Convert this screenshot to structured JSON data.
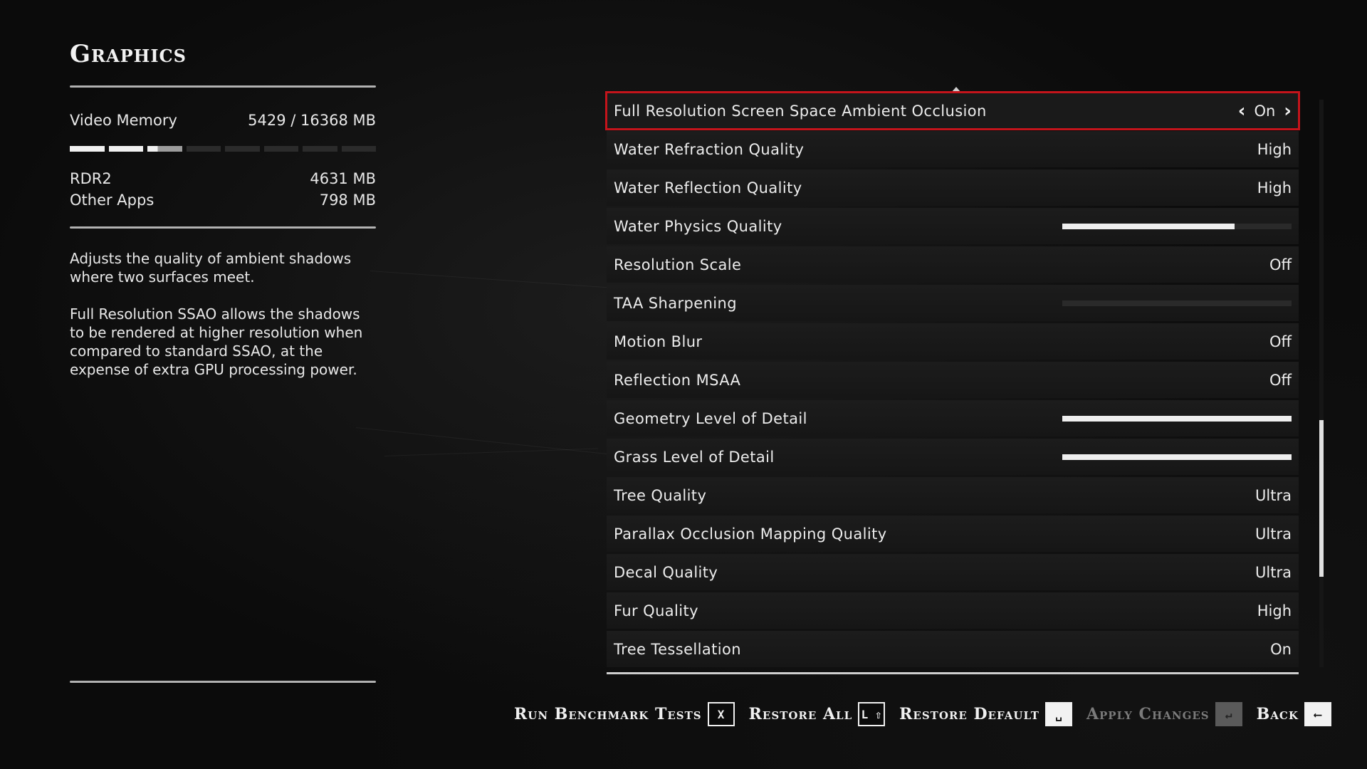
{
  "panel": {
    "title": "Graphics",
    "video_memory_label": "Video Memory",
    "video_memory_value": "5429  / 16368  MB",
    "memory_usage_fraction": 0.332,
    "rdr2_label": "RDR2",
    "rdr2_value": "4631  MB",
    "other_apps_label": "Other Apps",
    "other_apps_value": "798  MB",
    "description_1": "Adjusts the quality of ambient shadows where two surfaces meet.",
    "description_2": "Full Resolution SSAO allows the shadows to be rendered at higher resolution when compared to standard SSAO, at the expense of extra GPU processing power."
  },
  "settings": [
    {
      "label": "Full Resolution Screen Space Ambient Occlusion",
      "value": "On",
      "selected": true,
      "type": "option"
    },
    {
      "label": "Water Refraction Quality",
      "value": "High",
      "type": "option"
    },
    {
      "label": "Water Reflection Quality",
      "value": "High",
      "type": "option"
    },
    {
      "label": "Water Physics Quality",
      "type": "slider",
      "fill": 0.75
    },
    {
      "label": "Resolution Scale",
      "value": "Off",
      "type": "option"
    },
    {
      "label": "TAA Sharpening",
      "type": "slider",
      "fill": 0.0
    },
    {
      "label": "Motion Blur",
      "value": "Off",
      "type": "option"
    },
    {
      "label": "Reflection MSAA",
      "value": "Off",
      "type": "option"
    },
    {
      "label": "Geometry Level of Detail",
      "type": "slider",
      "fill": 1.0
    },
    {
      "label": "Grass Level of Detail",
      "type": "slider",
      "fill": 1.0
    },
    {
      "label": "Tree Quality",
      "value": "Ultra",
      "type": "option"
    },
    {
      "label": "Parallax Occlusion Mapping Quality",
      "value": "Ultra",
      "type": "option"
    },
    {
      "label": "Decal Quality",
      "value": "Ultra",
      "type": "option"
    },
    {
      "label": "Fur Quality",
      "value": "High",
      "type": "option"
    },
    {
      "label": "Tree Tessellation",
      "value": "On",
      "type": "option"
    }
  ],
  "scroll_position_fraction": 0.78,
  "hints": [
    {
      "label": "Run Benchmark Tests",
      "key": "X",
      "key_style": "outline",
      "enabled": true
    },
    {
      "label": "Restore All",
      "key": "L ⇧",
      "key_style": "outline",
      "enabled": true
    },
    {
      "label": "Restore Default",
      "key": "␣",
      "key_style": "solid",
      "enabled": true
    },
    {
      "label": "Apply Changes",
      "key": "↵",
      "key_style": "dim",
      "enabled": false
    },
    {
      "label": "Back",
      "key": "⟵",
      "key_style": "solid",
      "enabled": true
    }
  ],
  "colors": {
    "accent_selection": "#c4141b",
    "background": "#0b0b0b",
    "text": "#ececec"
  }
}
